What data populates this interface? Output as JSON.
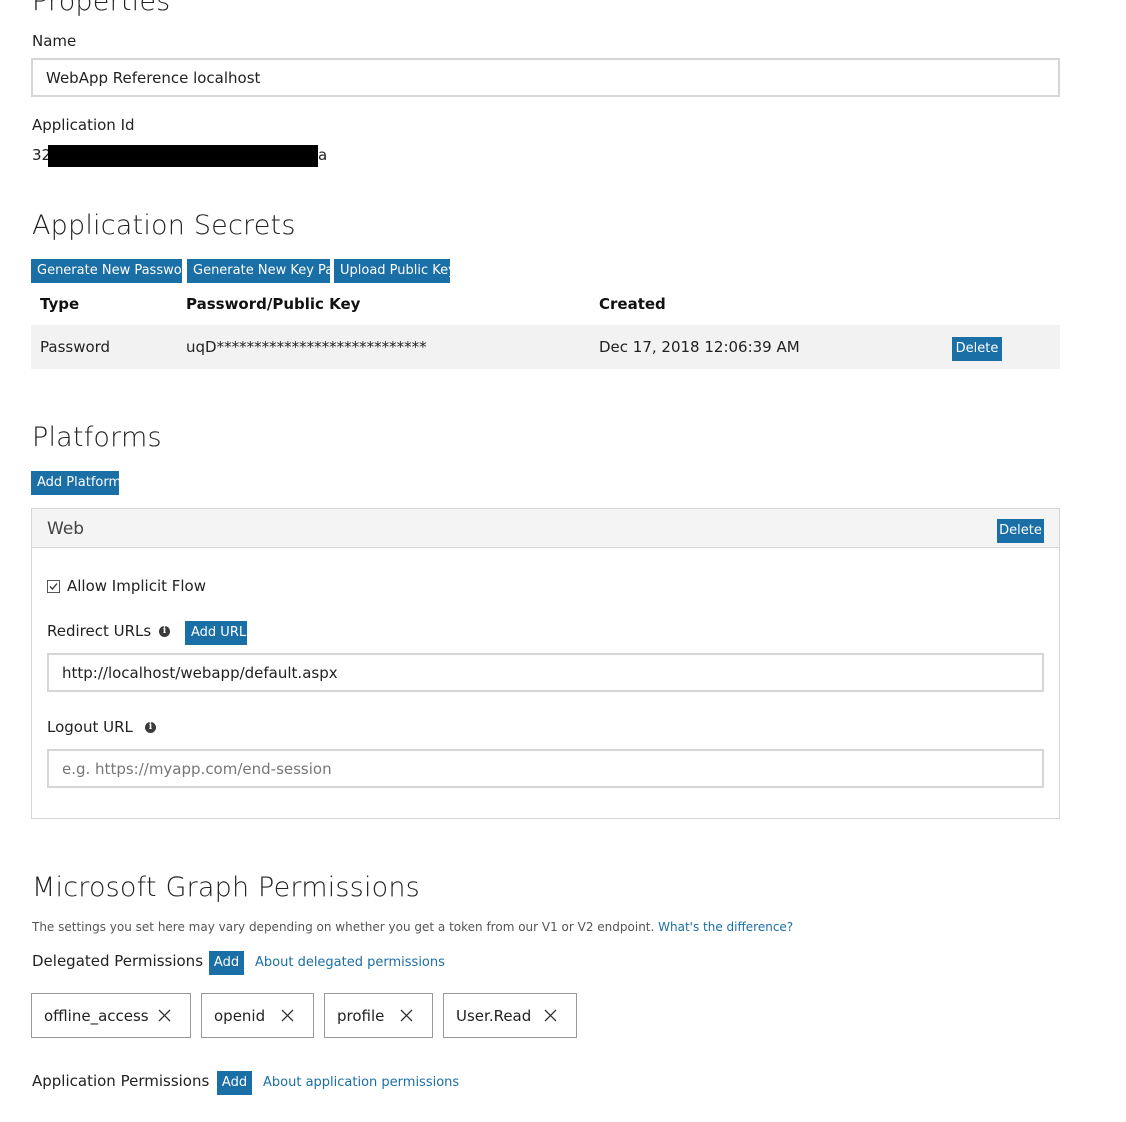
{
  "properties": {
    "title": "Properties",
    "name_label": "Name",
    "name_value": "WebApp Reference localhost",
    "app_id_label": "Application Id",
    "app_id_prefix": "32",
    "app_id_suffix": "a"
  },
  "secrets": {
    "title": "Application Secrets",
    "buttons": [
      "Generate New Password",
      "Generate New Key Pair",
      "Upload Public Key"
    ],
    "columns": [
      "Type",
      "Password/Public Key",
      "Created"
    ],
    "rows": [
      {
        "type": "Password",
        "key": "uqD****************************",
        "created": "Dec 17, 2018 12:06:39 AM",
        "delete_label": "Delete"
      }
    ]
  },
  "platforms": {
    "title": "Platforms",
    "add_label": "Add Platform",
    "web": {
      "title": "Web",
      "delete_label": "Delete",
      "implicit_flow_label": "Allow Implicit Flow",
      "implicit_flow_checked": true,
      "redirect_label": "Redirect URLs",
      "add_url_label": "Add URL",
      "redirect_value": "http://localhost/webapp/default.aspx",
      "logout_label": "Logout URL",
      "logout_placeholder": "e.g. https://myapp.com/end-session"
    }
  },
  "graph": {
    "title": "Microsoft Graph Permissions",
    "note": "The settings you set here may vary depending on whether you get a token from our V1 or V2 endpoint.",
    "note_link": "What's the difference?",
    "delegated_label": "Delegated Permissions",
    "add_label": "Add",
    "delegated_link": "About delegated permissions",
    "delegated": [
      "offline_access",
      "openid",
      "profile",
      "User.Read"
    ],
    "application_label": "Application Permissions",
    "application_link": "About application permissions"
  },
  "colors": {
    "accent": "#1a6fa6",
    "row_bg": "#f2f2f2",
    "redaction": "#000000"
  },
  "icons": {
    "info": "info-icon",
    "remove": "close-icon",
    "checkbox": "checkbox-icon"
  }
}
